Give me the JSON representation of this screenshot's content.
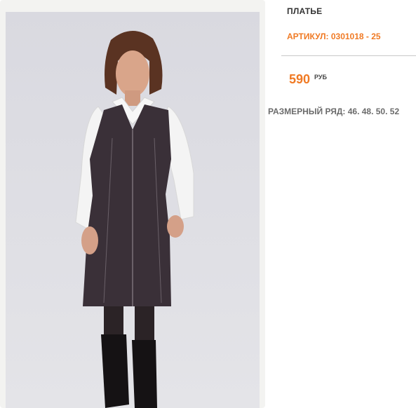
{
  "product": {
    "title": "ПЛАТЬЕ",
    "sku": "АРТИКУЛ: 0301018 - 25",
    "price": "590",
    "currency": "РУБ",
    "sizes": "РАЗМЕРНЫЙ РЯД: 46. 48. 50. 52"
  },
  "colors": {
    "accent": "#f07a24",
    "title": "#333333",
    "sizes": "#6b6b6b",
    "divider": "#c9c9c9"
  }
}
